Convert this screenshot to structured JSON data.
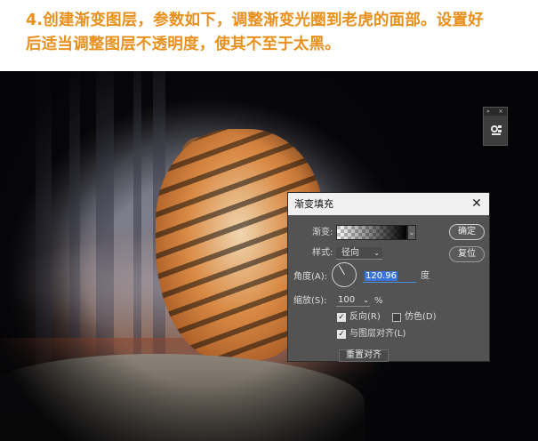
{
  "caption": {
    "line1": "4.创建渐变图层，参数如下，调整渐变光圈到老虎的面部。设置好",
    "line2": "后适当调整图层不透明度，使其不至于太黑。"
  },
  "mini_panel": {
    "collapse_glyph": "»",
    "close_glyph": "×",
    "icon": "layer-adjust-icon"
  },
  "dialog": {
    "title": "渐变填充",
    "close_glyph": "✕",
    "gradient_label": "渐变:",
    "style_label": "样式:",
    "style_value": "径向",
    "angle_label": "角度(A):",
    "angle_value": "120.96",
    "angle_unit": "度",
    "scale_label": "缩放(S):",
    "scale_value": "100",
    "scale_unit": "%",
    "reverse_label": "反向(R)",
    "reverse_checked": true,
    "dither_label": "仿色(D)",
    "dither_checked": false,
    "align_label": "与图层对齐(L)",
    "align_checked": true,
    "reset_align_button": "重置对齐",
    "ok_button": "确定",
    "reset_button": "复位",
    "dropdown_arrow": "⌄"
  },
  "colors": {
    "caption": "#e98f1c",
    "dialog_bg": "#535353",
    "highlight": "#3b73d6"
  }
}
